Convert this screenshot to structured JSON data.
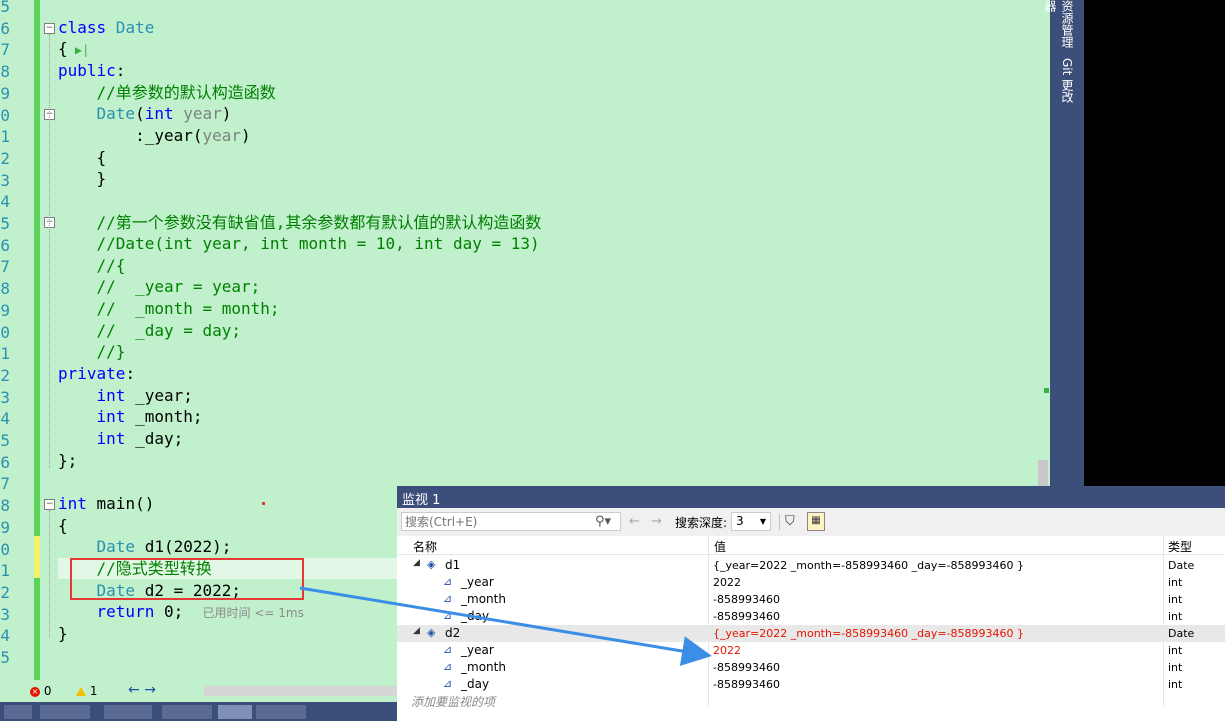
{
  "editor": {
    "line_numbers": [
      "5",
      "6",
      "7",
      "8",
      "9",
      "0",
      "1",
      "2",
      "3",
      "4",
      "5",
      "6",
      "7",
      "8",
      "9",
      "0",
      "1",
      "2",
      "3",
      "4",
      "5",
      "6",
      "7",
      "8",
      "9",
      "0",
      "1",
      "2",
      "3",
      "4",
      "5"
    ],
    "lines": {
      "l6": {
        "kw": "class",
        "ty": " Date"
      },
      "l7": {
        "txt": "{"
      },
      "l8": {
        "kw": "public",
        "txt": ":"
      },
      "l9": {
        "cm": "    //单参数的默认构造函数"
      },
      "l10": {
        "ty": "    Date",
        "p1": "(",
        "kw": "int",
        "pa": " year",
        "p2": ")"
      },
      "l11": {
        "txt": "        :_year(",
        "pa": "year",
        "p2": ")"
      },
      "l12": {
        "txt": "    {"
      },
      "l13": {
        "txt": "    }"
      },
      "l15": {
        "cm": "    //第一个参数没有缺省值,其余参数都有默认值的默认构造函数"
      },
      "l16": {
        "cm": "    //Date(int year, int month = 10, int day = 13)"
      },
      "l17": {
        "cm": "    //{"
      },
      "l18": {
        "cm": "    //  _year = year;"
      },
      "l19": {
        "cm": "    //  _month = month;"
      },
      "l20": {
        "cm": "    //  _day = day;"
      },
      "l21": {
        "cm": "    //}"
      },
      "l22": {
        "kw": "private",
        "txt": ":"
      },
      "l23": {
        "kw": "    int",
        "txt": " _year;"
      },
      "l24": {
        "kw": "    int",
        "txt": " _month;"
      },
      "l25": {
        "kw": "    int",
        "txt": " _day;"
      },
      "l26": {
        "txt": "};"
      },
      "l28": {
        "kw": "int",
        "txt": " main()"
      },
      "l29": {
        "txt": "{"
      },
      "l30": {
        "ty": "    Date",
        "txt": " d1(2022);"
      },
      "l31": {
        "cm": "    //隐式类型转换"
      },
      "l32": {
        "ty": "    Date",
        "txt": " d2 = 2022;"
      },
      "l33": {
        "kw": "    return",
        "txt": " 0;",
        "hint": "已用时间 <= 1ms"
      },
      "l34": {
        "txt": "}"
      }
    }
  },
  "sidebar": {
    "tab1": "资源管理器",
    "tab2": "Git 更改"
  },
  "statusbar": {
    "errors": "0",
    "warnings": "1",
    "back": "←",
    "forward": "→"
  },
  "watch": {
    "title": "监视 1",
    "search_placeholder": "搜索(Ctrl+E)",
    "depth_label": "搜索深度:",
    "depth_value": "3",
    "columns": {
      "name": "名称",
      "value": "值",
      "type": "类型"
    },
    "rows": [
      {
        "name": "d1",
        "value": "{_year=2022 _month=-858993460 _day=-858993460 }",
        "type": "Date"
      },
      {
        "name": "_year",
        "value": "2022",
        "type": "int"
      },
      {
        "name": "_month",
        "value": "-858993460",
        "type": "int"
      },
      {
        "name": "_day",
        "value": "-858993460",
        "type": "int"
      },
      {
        "name": "d2",
        "value": "{_year=2022 _month=-858993460 _day=-858993460 }",
        "type": "Date"
      },
      {
        "name": "_year",
        "value": "2022",
        "type": "int"
      },
      {
        "name": "_month",
        "value": "-858993460",
        "type": "int"
      },
      {
        "name": "_day",
        "value": "-858993460",
        "type": "int"
      }
    ],
    "add_placeholder": "添加要监视的项"
  },
  "colors": {
    "editor_bg": "#c1f0cd",
    "keyword": "#0000ff",
    "type": "#2b91af",
    "comment": "#008000",
    "changed_value": "#e51400",
    "annotation": "#e53935",
    "arrow": "#3a8ee6"
  }
}
